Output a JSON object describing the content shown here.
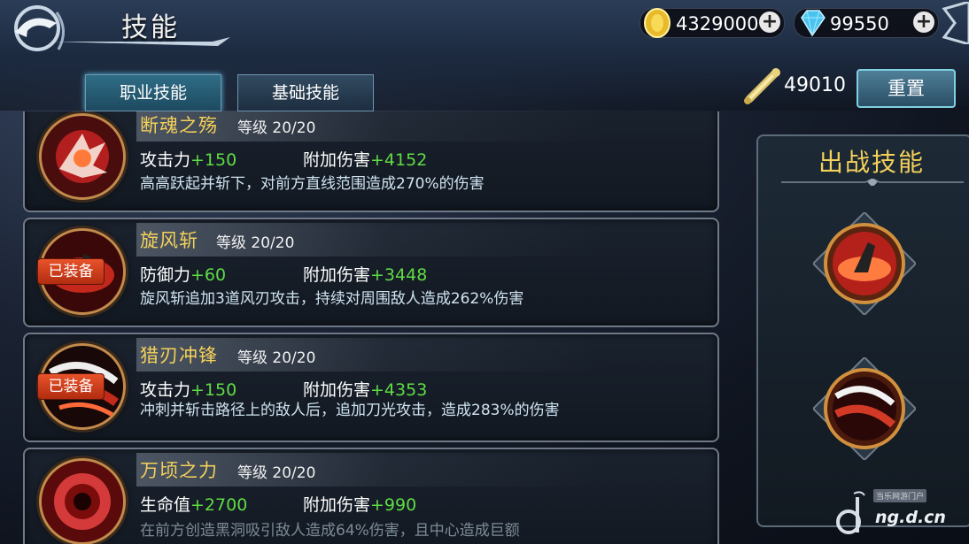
{
  "header": {
    "title": "技能",
    "back_icon": "back-arrow-icon"
  },
  "currencies": {
    "gold": {
      "value": "4329000",
      "icon": "gold-coin-icon"
    },
    "gem": {
      "value": "99550",
      "icon": "diamond-icon"
    }
  },
  "tabs": [
    {
      "label": "职业技能",
      "active": true
    },
    {
      "label": "基础技能",
      "active": false
    }
  ],
  "skill_points": {
    "value": "49010",
    "icon": "scroll-icon"
  },
  "reset_label": "重置",
  "skills": [
    {
      "name": "断魂之殇",
      "level": "等级 20/20",
      "stat1_label": "攻击力",
      "stat1_value": "+150",
      "stat2_label": "附加伤害",
      "stat2_value": "+4152",
      "desc": "高高跃起并斩下，对前方直线范围造成270%的伤害",
      "equipped": false,
      "equipped_label": ""
    },
    {
      "name": "旋风斩",
      "level": "等级 20/20",
      "stat1_label": "防御力",
      "stat1_value": "+60",
      "stat2_label": "附加伤害",
      "stat2_value": "+3448",
      "desc": "旋风斩追加3道风刃攻击，持续对周围敌人造成262%伤害",
      "equipped": true,
      "equipped_label": "已装备"
    },
    {
      "name": "猎刃冲锋",
      "level": "等级 20/20",
      "stat1_label": "攻击力",
      "stat1_value": "+150",
      "stat2_label": "附加伤害",
      "stat2_value": "+4353",
      "desc": "冲刺并斩击路径上的敌人后，追加刀光攻击，造成283%的伤害",
      "equipped": true,
      "equipped_label": "已装备"
    },
    {
      "name": "万顷之力",
      "level": "等级 20/20",
      "stat1_label": "生命值",
      "stat1_value": "+2700",
      "stat2_label": "附加伤害",
      "stat2_value": "+990",
      "desc": "在前方创造黑洞吸引敌人造成64%伤害，且中心造成巨额",
      "equipped": false,
      "equipped_label": ""
    }
  ],
  "side_panel": {
    "title": "出战技能",
    "slots": [
      "旋风斩",
      "猎刃冲锋"
    ]
  },
  "watermark": {
    "text": "ng.d.cn",
    "small": "当乐网游门户"
  },
  "colors": {
    "accent_gold": "#f4d15a",
    "stat_green": "#5fdc44",
    "badge_red": "#d8431e",
    "tab_active": "#2f6d86"
  }
}
